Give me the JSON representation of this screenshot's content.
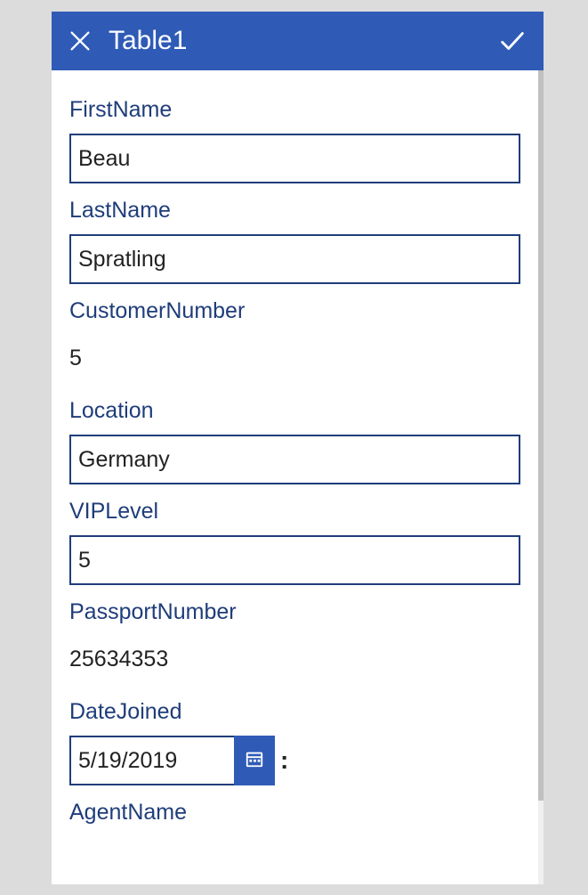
{
  "header": {
    "title": "Table1"
  },
  "form": {
    "firstName": {
      "label": "FirstName",
      "value": "Beau"
    },
    "lastName": {
      "label": "LastName",
      "value": "Spratling"
    },
    "customerNumber": {
      "label": "CustomerNumber",
      "value": "5"
    },
    "location": {
      "label": "Location",
      "value": "Germany"
    },
    "vipLevel": {
      "label": "VIPLevel",
      "value": "5"
    },
    "passportNumber": {
      "label": "PassportNumber",
      "value": "25634353"
    },
    "dateJoined": {
      "label": "DateJoined",
      "value": "5/19/2019",
      "separator": ":"
    },
    "agentName": {
      "label": "AgentName"
    }
  }
}
